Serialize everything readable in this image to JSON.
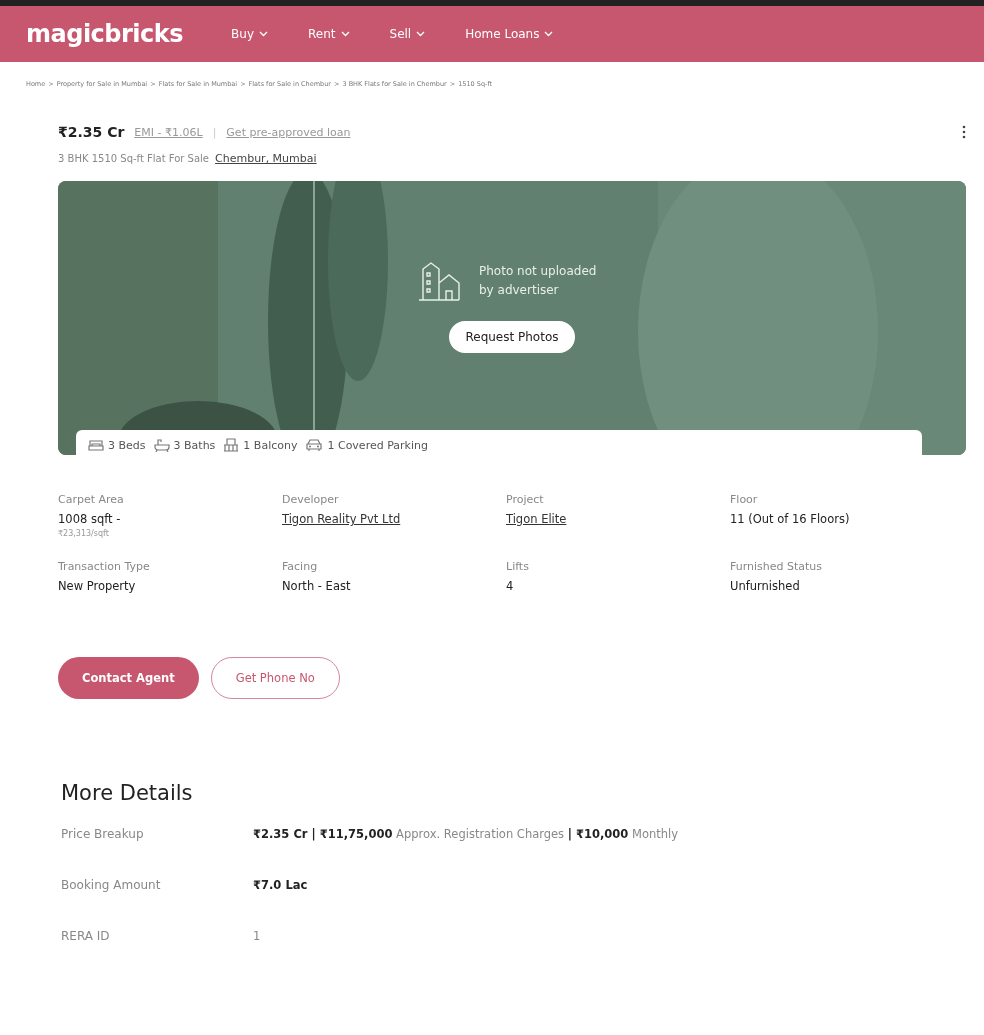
{
  "header": {
    "logo": "magicbricks",
    "nav": [
      {
        "label": "Buy"
      },
      {
        "label": "Rent"
      },
      {
        "label": "Sell"
      },
      {
        "label": "Home Loans"
      }
    ]
  },
  "breadcrumb": {
    "separator": ">",
    "items": [
      "Home",
      "Property for Sale in Mumbai",
      "Flats for Sale in Mumbai",
      "Flats for Sale in Chembur",
      "3 BHK Flats for Sale in Chembur",
      "1510 Sq-ft"
    ]
  },
  "listing": {
    "price": "₹2.35 Cr",
    "emi": "EMI - ₹1.06L",
    "separator": "|",
    "loan_link": "Get pre-approved loan",
    "subtitle": "3 BHK 1510 Sq-ft Flat For Sale",
    "location": "Chembur, Mumbai"
  },
  "photo": {
    "kind": "picture",
    "message": "Photo not uploaded by advertiser",
    "button": "Request Photos"
  },
  "amenities": [
    {
      "kind": "bed",
      "label": "3 Beds"
    },
    {
      "kind": "bath",
      "label": "3 Baths"
    },
    {
      "kind": "balcony",
      "label": "1 Balcony"
    },
    {
      "kind": "parking",
      "label": "1 Covered Parking"
    }
  ],
  "details": [
    {
      "label": "Carpet Area",
      "value": "1008 sqft -",
      "kind": "text",
      "sub": "₹23,313/sqft"
    },
    {
      "label": "Developer",
      "value": "Tigon Reality Pvt Ltd",
      "kind": "link"
    },
    {
      "label": "Project",
      "value": "Tigon Elite",
      "kind": "link"
    },
    {
      "label": "Floor",
      "value": "11 (Out of 16 Floors)",
      "kind": "text"
    },
    {
      "label": "Transaction Type",
      "value": "New Property",
      "kind": "text"
    },
    {
      "label": "Facing",
      "value": "North - East",
      "kind": "text"
    },
    {
      "label": "Lifts",
      "value": "4",
      "kind": "text"
    },
    {
      "label": "Furnished Status",
      "value": "Unfurnished",
      "kind": "text"
    }
  ],
  "actions": [
    {
      "label": "Contact Agent",
      "kind": "primary"
    },
    {
      "label": "Get Phone No",
      "kind": "secondary"
    }
  ],
  "more_details": {
    "title": "More Details",
    "rows": [
      {
        "label": "Price Breakup",
        "value": "**₹2.35 Cr | ₹11,75,000** Approx. Registration Charges **| ₹10,000** Monthly"
      },
      {
        "label": "Booking Amount",
        "value": "**₹7.0 Lac**"
      },
      {
        "label": "RERA ID",
        "value": "1"
      }
    ]
  }
}
